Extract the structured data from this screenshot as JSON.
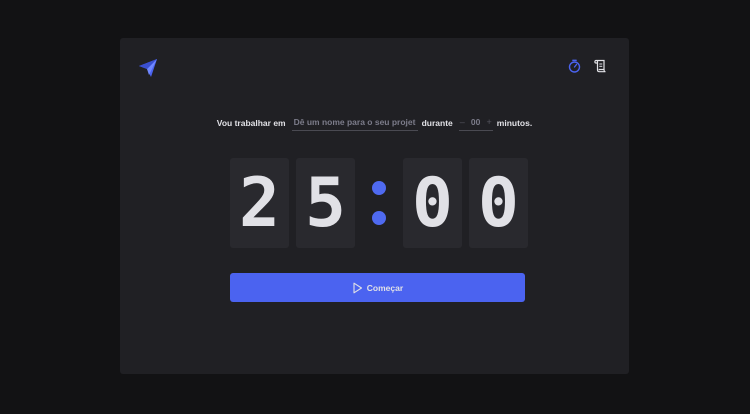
{
  "header": {
    "logo_icon": "paper-plane-icon",
    "nav": [
      {
        "name": "timer",
        "icon": "stopwatch-icon",
        "active": true
      },
      {
        "name": "history",
        "icon": "scroll-icon",
        "active": false
      }
    ]
  },
  "form": {
    "label_prefix": "Vou trabalhar em",
    "task_placeholder": "Dê um nome para o seu projeto",
    "label_middle": "durante",
    "minus_label": "–",
    "minutes_placeholder": "00",
    "plus_label": "+",
    "label_suffix": "minutos."
  },
  "timer": {
    "minutes_tens": "2",
    "minutes_ones": "5",
    "seconds_tens": "0",
    "seconds_ones": "0"
  },
  "start_button": {
    "label": "Começar",
    "icon": "play-icon"
  },
  "colors": {
    "background": "#121214",
    "card": "#202024",
    "digit_bg": "#29292e",
    "accent": "#4b63f0",
    "text": "#e1e1e6"
  }
}
